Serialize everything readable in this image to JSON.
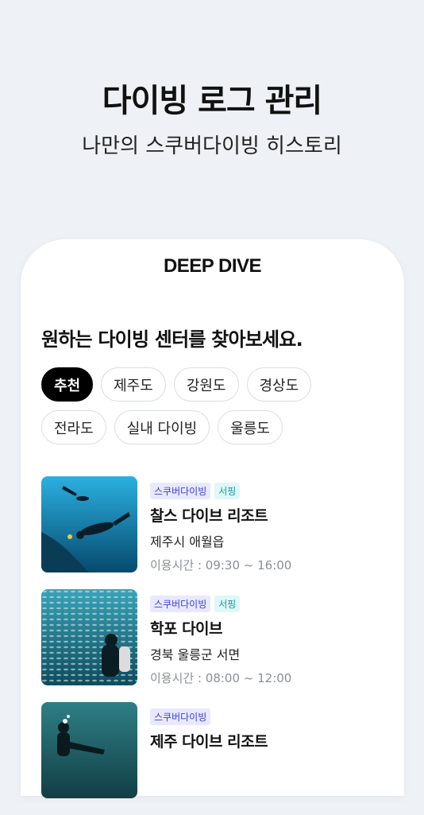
{
  "hero": {
    "title": "다이빙 로그 관리",
    "subtitle": "나만의 스쿠버다이빙 히스토리"
  },
  "app": {
    "brand": "DEEP DIVE",
    "heading": "원하는 다이빙 센터를 찾아보세요.",
    "chips_row1": [
      "추천",
      "제주도",
      "강원도",
      "경상도"
    ],
    "chips_row2": [
      "전라도",
      "실내 다이빙",
      "울릉도"
    ],
    "selected_chip": "추천",
    "centers": [
      {
        "tags": [
          "스쿠버다이빙",
          "서핑"
        ],
        "name": "찰스 다이브 리조트",
        "address": "제주시 애월읍",
        "hours": "이용시간 : 09:30 ~ 16:00"
      },
      {
        "tags": [
          "스쿠버다이빙",
          "서핑"
        ],
        "name": "학포 다이브",
        "address": "경북 울릉군 서면",
        "hours": "이용시간 : 08:00 ~ 12:00"
      },
      {
        "tags": [
          "스쿠버다이빙"
        ],
        "name": "제주 다이브 리조트",
        "address": "",
        "hours": ""
      }
    ]
  },
  "colors": {
    "tag_scuba_bg": "#e8e9ff",
    "tag_surf_bg": "#dff7f7",
    "active_chip": "#000000"
  }
}
